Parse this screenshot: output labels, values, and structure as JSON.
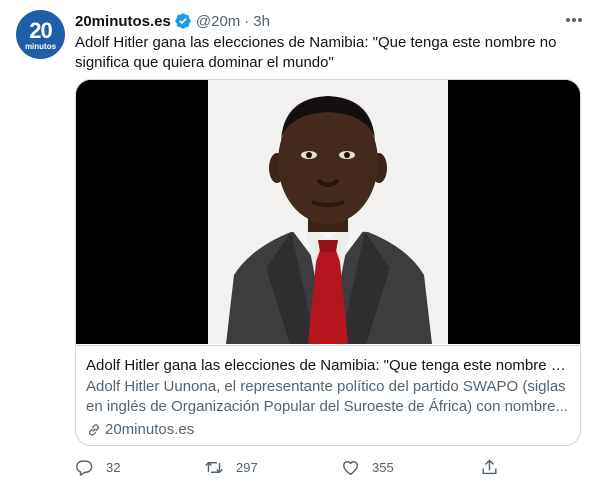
{
  "tweet": {
    "author_name": "20minutos.es",
    "handle": "@20m",
    "separator": "·",
    "time": "3h",
    "avatar_big": "20",
    "avatar_small": "minutos",
    "text": "Adolf Hitler gana las elecciones de Namibia: \"Que tenga este nombre no significa que quiera dominar el mundo\""
  },
  "card": {
    "title": "Adolf Hitler gana las elecciones de Namibia: \"Que tenga este nombre n...",
    "description": "Adolf Hitler Uunona, el representante político del partido SWAPO (siglas en inglés de Organización Popular del Suroeste de África) con nombre...",
    "domain": "20minutos.es"
  },
  "actions": {
    "replies": "32",
    "retweets": "297",
    "likes": "355"
  },
  "colors": {
    "brand": "#1f5ea8",
    "verified": "#1d9bf0",
    "secondary_text": "#536471",
    "border": "#cfd9de"
  },
  "icons": [
    "verified-badge-icon",
    "more-icon",
    "link-icon",
    "reply-icon",
    "retweet-icon",
    "like-icon",
    "share-icon"
  ]
}
